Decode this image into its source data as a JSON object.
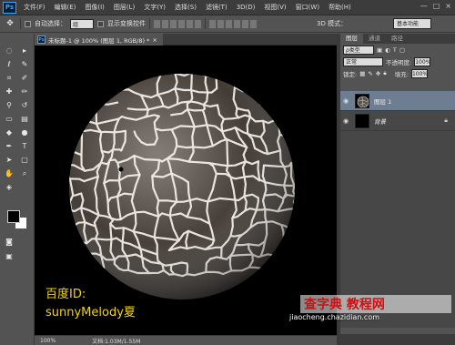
{
  "menubar": {
    "app_logo": "Ps",
    "items": [
      "文件(F)",
      "编辑(E)",
      "图像(I)",
      "图层(L)",
      "文字(Y)",
      "选择(S)",
      "滤镜(T)",
      "3D(D)",
      "视图(V)",
      "窗口(W)",
      "帮助(H)"
    ],
    "window_controls": [
      "—",
      "□",
      "×"
    ]
  },
  "options": {
    "auto_select_label": "自动选择：",
    "auto_select_value": "组",
    "transform_label": "显示变换控件",
    "mode3d_label": "3D 模式：",
    "workspace_value": "基本功能"
  },
  "document": {
    "tab_title": "未标题-1 @ 100% (图层 1, RGB/8) *",
    "caption_line1": "百度ID:",
    "caption_line2": "sunnyMelody夏"
  },
  "statusbar": {
    "zoom": "100%",
    "doc_info": "文档:1.03M/1.55M"
  },
  "panel": {
    "tabs": [
      "图层",
      "通道",
      "路径"
    ],
    "kind_label": "ρ类型",
    "blend_mode": "正常",
    "opacity_label": "不透明度:",
    "opacity_value": "100%",
    "lock_label": "锁定:",
    "fill_label": "填充:",
    "fill_value": "100%",
    "layers": [
      {
        "name": "图层 1",
        "selected": true
      },
      {
        "name": "背景",
        "selected": false
      }
    ]
  },
  "watermark": {
    "brand": "查字典 教程网",
    "url": "jiaocheng.chazidian.com"
  }
}
